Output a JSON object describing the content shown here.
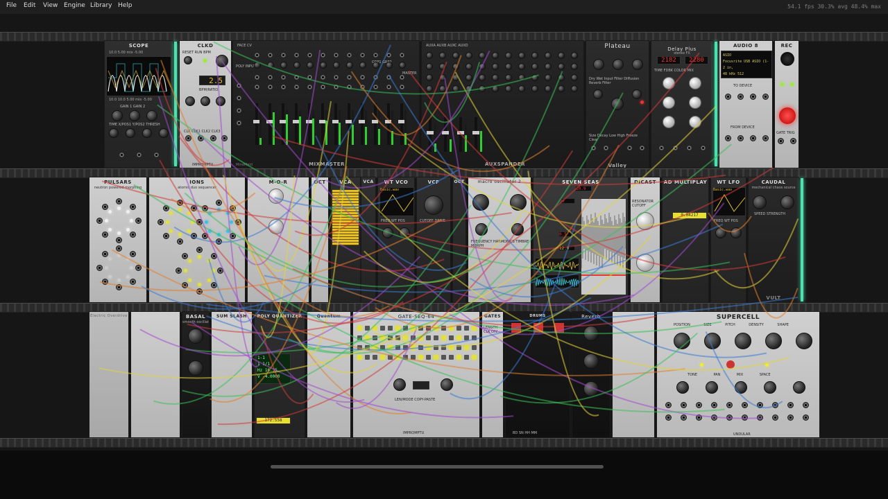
{
  "menu": {
    "file": "File",
    "edit": "Edit",
    "view": "View",
    "engine": "Engine",
    "library": "Library",
    "help": "Help"
  },
  "perf": "54.1 fps  30.3% avg  48.4% max",
  "modules": {
    "scope": {
      "title": "SCOPE",
      "row1": "10.0  5.00 mix -5.00",
      "row2": "10.0  10.0  5.00 mix -5.00",
      "labels": "GAIN 1   GAIN 2",
      "labels2": "TIME   X/POS1   Y/POS2   THRESH"
    },
    "clkd": {
      "title": "CLKD",
      "reset": "RESET",
      "run": "RUN",
      "bpm": "BPM",
      "display": "2.5",
      "ratio": "BPM/RATIO",
      "ports": "CLK  CLK1  CLK2  CLK3",
      "brand": "IMPROMPTU"
    },
    "mixmaster": {
      "title": "MIXMASTER",
      "brand": "MindMeld",
      "face": "FACE CV",
      "polyin": "POLY INPUTS",
      "grp": "GRP1  GRP2",
      "master": "MASTER"
    },
    "auxspander": {
      "title": "AUXSPANDER",
      "labels": "AUXA  AUXB  AUXC  AUXD"
    },
    "plateau": {
      "title": "Plateau",
      "brand": "Valley",
      "labels": "Dry  Wet  Input Filter  Diffusion  Reverb Filter",
      "labels2": "Size  Decay  Low  High  Freeze  Clear"
    },
    "delayplus": {
      "title": "Delay Plus",
      "sub": "stereo FX",
      "display_l": "2182",
      "display_r": "2280",
      "labels": "TIME  FDBK  COLOR  MIX"
    },
    "audio8": {
      "title": "AUDIO 8",
      "line1": "ASIO",
      "line2": "Focusrite USB ASIO (1-2 in,",
      "line3": "48 kHz         512",
      "todevice": "TO DEVICE",
      "fromdevice": "FROM DEVICE"
    },
    "rec": {
      "title": "REC",
      "gate": "GATE  TRIG"
    },
    "pulsars": {
      "title": "PULSARS",
      "sub": "neutron powered morphing"
    },
    "ions": {
      "title": "IONS",
      "sub": "atomic duo sequencer"
    },
    "mor": {
      "title": "M-O-R"
    },
    "vca": {
      "title": "VCA"
    },
    "vca2": {
      "title": "VCA"
    },
    "oct": {
      "title": "OCT"
    },
    "wtvco": {
      "title": "WT VCO",
      "wave": "Basic.wav",
      "labels": "FREQ   WT POS"
    },
    "vcf": {
      "title": "VCF",
      "labels": "CUTOFF   DRIVE"
    },
    "oct2": {
      "title": "OCT"
    },
    "macro": {
      "title": "macro oscillator 2",
      "labels": "FREQUENCY  HARMONICS  TIMBRE  MORPH"
    },
    "sevenseas": {
      "title": "SEVEN SEAS",
      "readout1": "10.9",
      "readout2": "0",
      "readout3": "0.5",
      "readout4": "12.0"
    },
    "dicast": {
      "title": "DICAST",
      "labels": "RESONATOR   CUTOFF"
    },
    "adultiplus": {
      "title": "AD MULTIPLAY",
      "value": "0.04217"
    },
    "wtlfo": {
      "title": "WT LFO",
      "wave": "Basic.wav",
      "labels": "FREQ  WT POS"
    },
    "caudal": {
      "title": "CAUDAL",
      "sub": "mechanical chaos source",
      "labels": "SPEED  STRENGTH",
      "brand": "VULT"
    },
    "elecrow": {
      "title": "Electric Overdrive"
    },
    "basal": {
      "title": "BASAL",
      "sub": "smooth oscillator"
    },
    "sum": {
      "title": "SUM SLASH"
    },
    "quant": {
      "title": "POLY QUANTIZER",
      "screen": "1-1\n1 1/1\nHz 16.35\nV -4.0000",
      "value": "172.558"
    },
    "quantum": {
      "title": "Quantum"
    },
    "gateseq": {
      "title": "GATE-SEQ-64",
      "labels": "LEN/MODE   COPY-PASTE",
      "brand": "IMPROMPTU"
    },
    "gates": {
      "title": "GATES",
      "labels": "LENGTH  CLK DIV"
    },
    "drums": {
      "title": "DRUMS",
      "labels": "BD  SN  HH  MM"
    },
    "reverb": {
      "title": "Reverb"
    },
    "supercell": {
      "title": "SUPERCELL",
      "labels": "POSITION  SIZE  PITCH  DENSITY  SHAPE",
      "labels2": "TONE  PAN  MIX  SPACE",
      "brand": "UNDULAR"
    }
  },
  "colors": {
    "accent": "#4fe0b0",
    "cable_red": "#d23a3a",
    "cable_yellow": "#e2d33a",
    "cable_green": "#3ac05a",
    "cable_blue": "#3a7ad2",
    "cable_purple": "#a24ad0",
    "cable_orange": "#e08030"
  }
}
